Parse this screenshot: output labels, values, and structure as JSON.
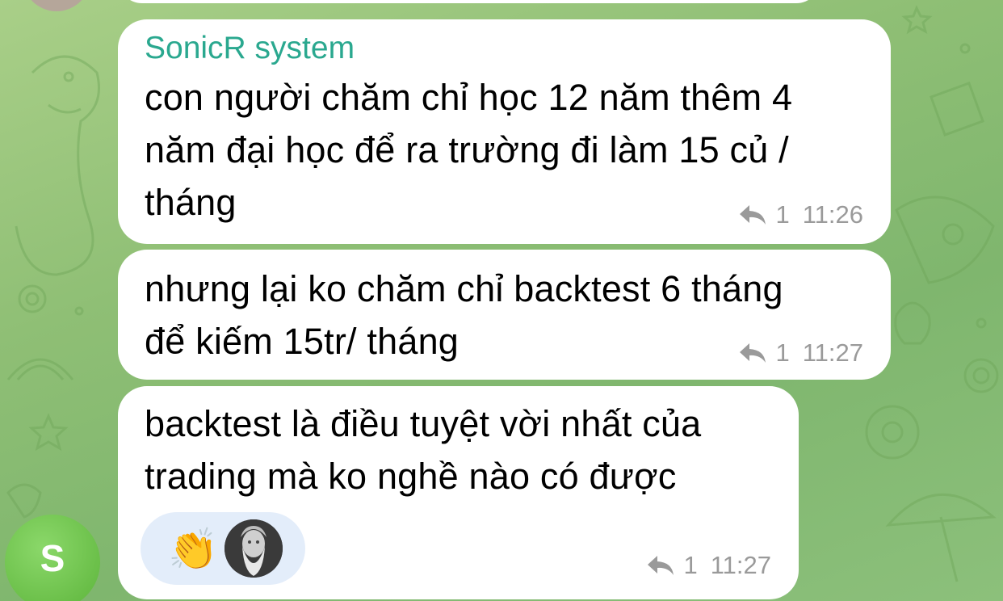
{
  "chat": {
    "messages": [
      {
        "sender": "SonicR system",
        "text": "con người chăm chỉ học 12 năm thêm 4\nnăm đại học để ra trường đi làm 15 củ /\ntháng",
        "replies": "1",
        "time": "11:26"
      },
      {
        "text": "nhưng lại ko chăm chỉ backtest 6 tháng\nđể kiếm 15tr/ tháng",
        "replies": "1",
        "time": "11:27"
      },
      {
        "text": "backtest là điều tuyệt vời nhất của\ntrading mà ko nghề nào có được",
        "replies": "1",
        "time": "11:27",
        "reaction_emoji": "👏"
      }
    ],
    "sender_avatar_letter": "S"
  },
  "colors": {
    "sender_name": "#2aa88f",
    "background": "#8fbf75",
    "reaction_pill": "#e3edfa",
    "avatar": "#5cb43a"
  },
  "icons": [
    "reply-count-icon",
    "clapping-hands-emoji",
    "reactor-avatar"
  ]
}
